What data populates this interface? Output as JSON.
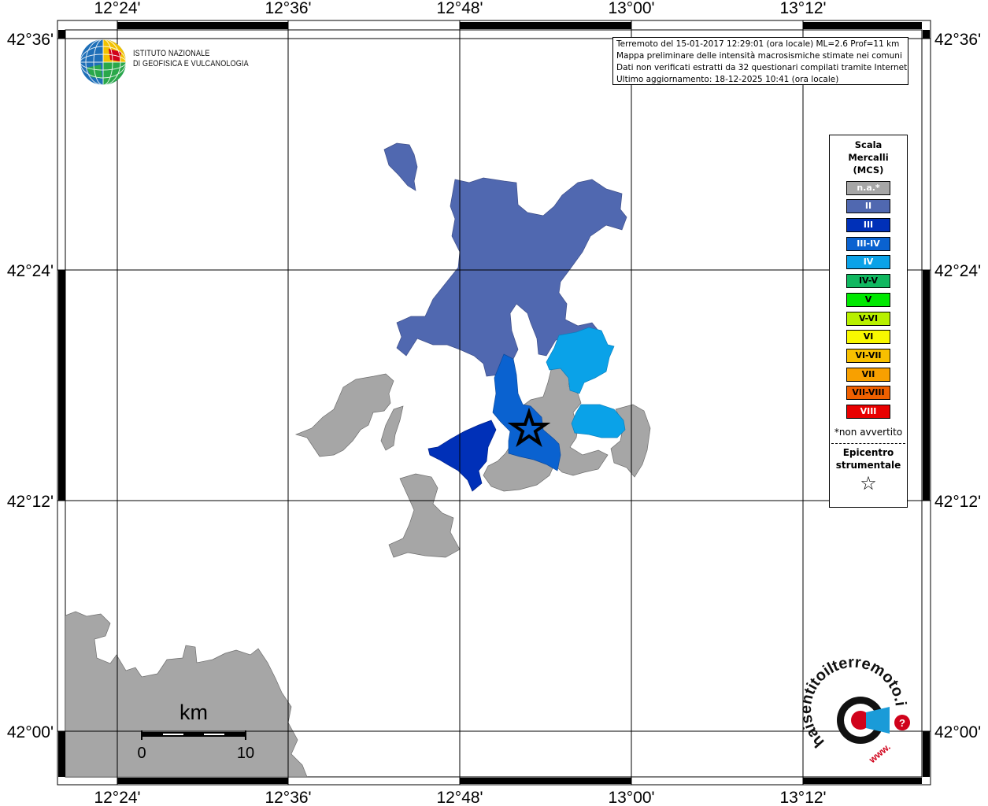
{
  "map": {
    "lat_labels": [
      "42°36'",
      "42°24'",
      "42°12'",
      "42°00'"
    ],
    "lon_labels": [
      "12°24'",
      "12°36'",
      "12°48'",
      "13°00'",
      "13°12'"
    ]
  },
  "event_info": {
    "line1": "Terremoto del 15-01-2017 12:29:01 (ora locale) ML=2.6 Prof=11 km",
    "line2": "Mappa preliminare delle intensità macrosismiche stimate nei comuni",
    "line3": "Dati non verificati estratti da 32 questionari compilati tramite Internet.",
    "line4": "Ultimo aggiornamento: 18-12-2025 10:41 (ora locale)"
  },
  "logo": {
    "line1": "ISTITUTO NAZIONALE",
    "line2": "DI GEOFISICA E VULCANOLOGIA"
  },
  "legend": {
    "title_line1": "Scala",
    "title_line2": "Mercalli",
    "title_line3": "(MCS)",
    "items": [
      {
        "label": "n.a.*",
        "color": "#a6a6a6",
        "text_color": "#ffffff"
      },
      {
        "label": "II",
        "color": "#5068b0",
        "text_color": "#ffffff"
      },
      {
        "label": "III",
        "color": "#0030b8",
        "text_color": "#ffffff"
      },
      {
        "label": "III-IV",
        "color": "#0a62d0",
        "text_color": "#ffffff"
      },
      {
        "label": "IV",
        "color": "#0aa2e8",
        "text_color": "#ffffff"
      },
      {
        "label": "IV-V",
        "color": "#10b860",
        "text_color": "#000000"
      },
      {
        "label": "V",
        "color": "#00e800",
        "text_color": "#000000"
      },
      {
        "label": "V-VI",
        "color": "#b8f000",
        "text_color": "#000000"
      },
      {
        "label": "VI",
        "color": "#f8f800",
        "text_color": "#000000"
      },
      {
        "label": "VI-VII",
        "color": "#f8c000",
        "text_color": "#000000"
      },
      {
        "label": "VII",
        "color": "#f8a000",
        "text_color": "#000000"
      },
      {
        "label": "VII-VIII",
        "color": "#f06000",
        "text_color": "#000000"
      },
      {
        "label": "VIII",
        "color": "#e80000",
        "text_color": "#ffffff"
      }
    ],
    "note": "*non avvertito",
    "epicenter_line1": "Epicentro",
    "epicenter_line2": "strumentale",
    "epicenter_symbol": "☆"
  },
  "scale_bar": {
    "unit": "km",
    "start": "0",
    "end": "10"
  },
  "hsit_logo": {
    "text": "haisentitoilterremoto.it",
    "url_prefix": "www."
  }
}
